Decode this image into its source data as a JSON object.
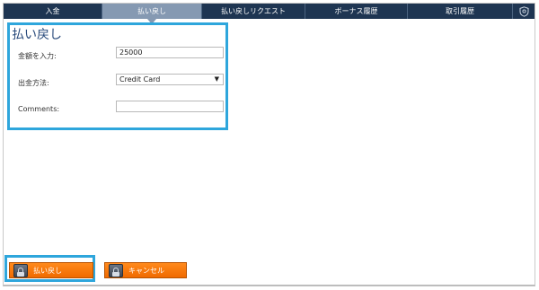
{
  "tabs": [
    {
      "label": "入金",
      "active": false
    },
    {
      "label": "払い戻し",
      "active": true
    },
    {
      "label": "払い戻しリクエスト",
      "active": false
    },
    {
      "label": "ボーナス履歴",
      "active": false
    },
    {
      "label": "取引履歴",
      "active": false
    }
  ],
  "tab_icon": "shield-icon",
  "form": {
    "title": "払い戻し",
    "amount_label": "金額を入力:",
    "amount_value": "25000",
    "method_label": "出金方法:",
    "method_value": "Credit Card",
    "comments_label": "Comments:",
    "comments_value": ""
  },
  "buttons": {
    "withdraw_label": "払い戻し",
    "cancel_label": "キャンセル"
  },
  "colors": {
    "tabbar": "#1e3552",
    "active_tab": "#8599b2",
    "highlight": "#2ea6dc",
    "button": "#f47a0c"
  }
}
